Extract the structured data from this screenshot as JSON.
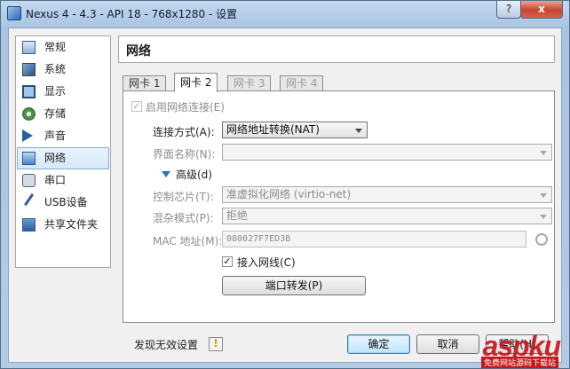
{
  "window": {
    "title": "Nexus 4 - 4.3 - API 18 - 768x1280 - 设置",
    "help_label": "?",
    "close_label": "x"
  },
  "sidebar": {
    "items": [
      {
        "label": "常规",
        "icon": "general-icon"
      },
      {
        "label": "系统",
        "icon": "system-icon"
      },
      {
        "label": "显示",
        "icon": "display-icon"
      },
      {
        "label": "存储",
        "icon": "storage-icon"
      },
      {
        "label": "声音",
        "icon": "audio-icon"
      },
      {
        "label": "网络",
        "icon": "network-icon",
        "selected": true
      },
      {
        "label": "串口",
        "icon": "serial-port-icon"
      },
      {
        "label": "USB设备",
        "icon": "usb-icon"
      },
      {
        "label": "共享文件夹",
        "icon": "shared-folder-icon"
      }
    ]
  },
  "page": {
    "title": "网络"
  },
  "tabs": [
    {
      "label": "网卡 1",
      "state": "normal"
    },
    {
      "label": "网卡 2",
      "state": "active"
    },
    {
      "label": "网卡 3",
      "state": "disabled"
    },
    {
      "label": "网卡 4",
      "state": "disabled"
    }
  ],
  "adapter": {
    "enable_label": "启用网络连接(E)",
    "enable_checked": true,
    "attached_to_label": "连接方式(A):",
    "attached_to_value": "网络地址转换(NAT)",
    "name_label": "界面名称(N):",
    "name_value": "",
    "advanced_label": "高级(d)",
    "adapter_type_label": "控制芯片(T):",
    "adapter_type_value": "准虚拟化网络 (virtio-net)",
    "promiscuous_label": "混杂模式(P):",
    "promiscuous_value": "拒绝",
    "mac_label": "MAC 地址(M):",
    "mac_value": "080027F7ED3B",
    "cable_label": "接入网线(C)",
    "cable_checked": true,
    "port_forward_label": "端口转发(P)"
  },
  "footer": {
    "invalid_settings_label": "发现无效设置",
    "warning_icon": "!",
    "ok_label": "确定",
    "cancel_label": "取消",
    "help_label": "帮助(H)"
  },
  "watermark": {
    "brand": "aspku",
    "tagline": "免费网站源码下载站"
  },
  "colors": {
    "title_bar": "#b4cbe5",
    "selected_item": "#d7e8f9",
    "accent": "#2a72c8"
  }
}
